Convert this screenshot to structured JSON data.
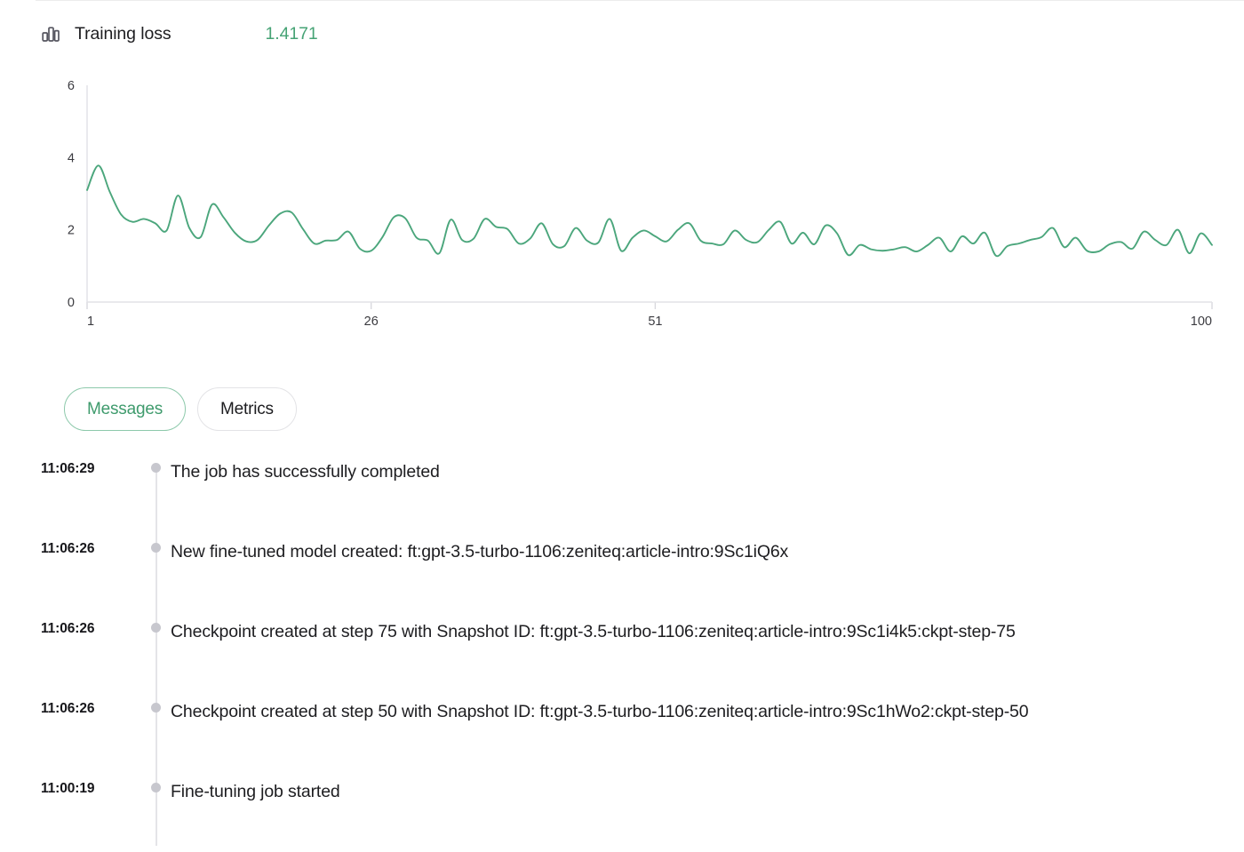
{
  "metric": {
    "icon": "bar-chart-icon",
    "title": "Training loss",
    "value": "1.4171",
    "value_color": "#46a375"
  },
  "tabs": [
    {
      "label": "Messages",
      "active": true
    },
    {
      "label": "Metrics",
      "active": false
    }
  ],
  "messages": [
    {
      "time": "11:06:29",
      "text": "The job has successfully completed"
    },
    {
      "time": "11:06:26",
      "text": "New fine-tuned model created: ft:gpt-3.5-turbo-1106:zeniteq:article-intro:9Sc1iQ6x"
    },
    {
      "time": "11:06:26",
      "text": "Checkpoint created at step 75 with Snapshot ID: ft:gpt-3.5-turbo-1106:zeniteq:article-intro:9Sc1i4k5:ckpt-step-75"
    },
    {
      "time": "11:06:26",
      "text": "Checkpoint created at step 50 with Snapshot ID: ft:gpt-3.5-turbo-1106:zeniteq:article-intro:9Sc1hWo2:ckpt-step-50"
    },
    {
      "time": "11:00:19",
      "text": "Fine-tuning job started"
    }
  ],
  "chart_data": {
    "type": "line",
    "title": "Training loss",
    "xlabel": "",
    "ylabel": "",
    "xticks": [
      "1",
      "26",
      "51",
      "100"
    ],
    "xtick_values": [
      1,
      26,
      51,
      100
    ],
    "yticks": [
      "0",
      "2",
      "4",
      "6"
    ],
    "ytick_values": [
      0,
      2,
      4,
      6
    ],
    "xlim": [
      1,
      100
    ],
    "ylim": [
      0,
      6
    ],
    "grid": false,
    "legend": null,
    "series": [
      {
        "name": "Training loss",
        "color": "#4ba67c",
        "x": [
          1,
          2,
          3,
          4,
          5,
          6,
          7,
          8,
          9,
          10,
          11,
          12,
          13,
          14,
          15,
          16,
          17,
          18,
          19,
          20,
          21,
          22,
          23,
          24,
          25,
          26,
          27,
          28,
          29,
          30,
          31,
          32,
          33,
          34,
          35,
          36,
          37,
          38,
          39,
          40,
          41,
          42,
          43,
          44,
          45,
          46,
          47,
          48,
          49,
          50,
          51,
          52,
          53,
          54,
          55,
          56,
          57,
          58,
          59,
          60,
          61,
          62,
          63,
          64,
          65,
          66,
          67,
          68,
          69,
          70,
          71,
          72,
          73,
          74,
          75,
          76,
          77,
          78,
          79,
          80,
          81,
          82,
          83,
          84,
          85,
          86,
          87,
          88,
          89,
          90,
          91,
          92,
          93,
          94,
          95,
          96,
          97,
          98,
          99,
          100
        ],
        "values": [
          3.1,
          3.78,
          3.05,
          2.42,
          2.22,
          2.3,
          2.18,
          1.98,
          2.95,
          2.05,
          1.8,
          2.7,
          2.35,
          1.92,
          1.68,
          1.72,
          2.12,
          2.45,
          2.48,
          2.02,
          1.62,
          1.7,
          1.72,
          1.95,
          1.48,
          1.42,
          1.8,
          2.35,
          2.32,
          1.78,
          1.7,
          1.35,
          2.28,
          1.72,
          1.75,
          2.3,
          2.08,
          2.02,
          1.62,
          1.76,
          2.18,
          1.6,
          1.55,
          2.05,
          1.7,
          1.65,
          2.3,
          1.42,
          1.78,
          1.98,
          1.82,
          1.68,
          2.0,
          2.18,
          1.7,
          1.62,
          1.6,
          1.98,
          1.72,
          1.66,
          2.0,
          2.22,
          1.62,
          1.92,
          1.6,
          2.12,
          1.9,
          1.3,
          1.58,
          1.46,
          1.42,
          1.46,
          1.52,
          1.4,
          1.58,
          1.78,
          1.4,
          1.82,
          1.62,
          1.92,
          1.28,
          1.55,
          1.62,
          1.72,
          1.8,
          2.05,
          1.52,
          1.78,
          1.42,
          1.4,
          1.6,
          1.66,
          1.48,
          1.95,
          1.72,
          1.58,
          2.0,
          1.35,
          1.9,
          1.58
        ]
      }
    ]
  }
}
